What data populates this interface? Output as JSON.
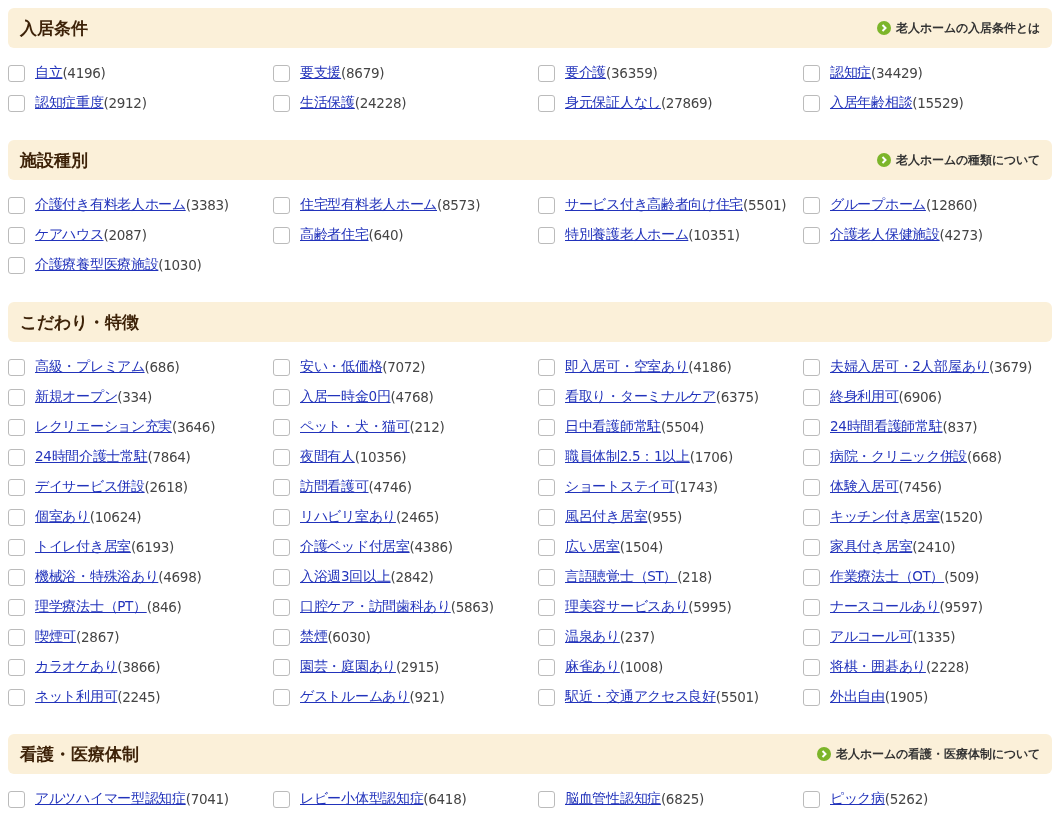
{
  "sections": [
    {
      "title": "入居条件",
      "link": "老人ホームの入居条件とは",
      "items": [
        {
          "label": "自立",
          "count": "(4196)",
          "checked": false
        },
        {
          "label": "要支援",
          "count": "(8679)",
          "checked": false
        },
        {
          "label": "要介護",
          "count": "(36359)",
          "checked": false
        },
        {
          "label": "認知症",
          "count": "(34429)",
          "checked": false
        },
        {
          "label": "認知症重度",
          "count": "(2912)",
          "checked": false
        },
        {
          "label": "生活保護",
          "count": "(24228)",
          "checked": false
        },
        {
          "label": "身元保証人なし",
          "count": "(27869)",
          "checked": false
        },
        {
          "label": "入居年齢相談",
          "count": "(15529)",
          "checked": false
        }
      ]
    },
    {
      "title": "施設種別",
      "link": "老人ホームの種類について",
      "items": [
        {
          "label": "介護付き有料老人ホーム",
          "count": "(3383)",
          "checked": false
        },
        {
          "label": "住宅型有料老人ホーム",
          "count": "(8573)",
          "checked": false
        },
        {
          "label": "サービス付き高齢者向け住宅",
          "count": "(5501)",
          "checked": false
        },
        {
          "label": "グループホーム",
          "count": "(12860)",
          "checked": false
        },
        {
          "label": "ケアハウス",
          "count": "(2087)",
          "checked": false
        },
        {
          "label": "高齢者住宅",
          "count": "(640)",
          "checked": false
        },
        {
          "label": "特別養護老人ホーム",
          "count": "(10351)",
          "checked": false
        },
        {
          "label": "介護老人保健施設",
          "count": "(4273)",
          "checked": false
        },
        {
          "label": "介護療養型医療施設",
          "count": "(1030)",
          "checked": false
        }
      ]
    },
    {
      "title": "こだわり・特徴",
      "items": [
        {
          "label": "高級・プレミアム",
          "count": "(686)",
          "checked": false
        },
        {
          "label": "安い・低価格",
          "count": "(7072)",
          "checked": false
        },
        {
          "label": "即入居可・空室あり",
          "count": "(4186)",
          "checked": false
        },
        {
          "label": "夫婦入居可・2人部屋あり",
          "count": "(3679)",
          "checked": false
        },
        {
          "label": "新規オープン",
          "count": "(334)",
          "checked": false
        },
        {
          "label": "入居一時金0円",
          "count": "(4768)",
          "checked": false
        },
        {
          "label": "看取り・ターミナルケア",
          "count": "(6375)",
          "checked": false
        },
        {
          "label": "終身利用可",
          "count": "(6906)",
          "checked": false
        },
        {
          "label": "レクリエーション充実",
          "count": "(3646)",
          "checked": false
        },
        {
          "label": "ペット・犬・猫可",
          "count": "(212)",
          "checked": false
        },
        {
          "label": "日中看護師常駐",
          "count": "(5504)",
          "checked": false
        },
        {
          "label": "24時間看護師常駐",
          "count": "(837)",
          "checked": false
        },
        {
          "label": "24時間介護士常駐",
          "count": "(7864)",
          "checked": false
        },
        {
          "label": "夜間有人",
          "count": "(10356)",
          "checked": false
        },
        {
          "label": "職員体制2.5：1以上",
          "count": "(1706)",
          "checked": false
        },
        {
          "label": "病院・クリニック併設",
          "count": "(668)",
          "checked": false
        },
        {
          "label": "デイサービス併設",
          "count": "(2618)",
          "checked": false
        },
        {
          "label": "訪問看護可",
          "count": "(4746)",
          "checked": false
        },
        {
          "label": "ショートステイ可",
          "count": "(1743)",
          "checked": false
        },
        {
          "label": "体験入居可",
          "count": "(7456)",
          "checked": false
        },
        {
          "label": "個室あり",
          "count": "(10624)",
          "checked": false
        },
        {
          "label": "リハビリ室あり",
          "count": "(2465)",
          "checked": false
        },
        {
          "label": "風呂付き居室",
          "count": "(955)",
          "checked": false
        },
        {
          "label": "キッチン付き居室",
          "count": "(1520)",
          "checked": false
        },
        {
          "label": "トイレ付き居室",
          "count": "(6193)",
          "checked": false
        },
        {
          "label": "介護ベッド付居室",
          "count": "(4386)",
          "checked": false
        },
        {
          "label": "広い居室",
          "count": "(1504)",
          "checked": false
        },
        {
          "label": "家具付き居室",
          "count": "(2410)",
          "checked": false
        },
        {
          "label": "機械浴・特殊浴あり",
          "count": "(4698)",
          "checked": false
        },
        {
          "label": "入浴週3回以上",
          "count": "(2842)",
          "checked": false
        },
        {
          "label": "言語聴覚士（ST）",
          "count": "(218)",
          "checked": false
        },
        {
          "label": "作業療法士（OT）",
          "count": "(509)",
          "checked": false
        },
        {
          "label": "理学療法士（PT）",
          "count": "(846)",
          "checked": false
        },
        {
          "label": "口腔ケア・訪問歯科あり",
          "count": "(5863)",
          "checked": false
        },
        {
          "label": "理美容サービスあり",
          "count": "(5995)",
          "checked": false
        },
        {
          "label": "ナースコールあり",
          "count": "(9597)",
          "checked": false
        },
        {
          "label": "喫煙可",
          "count": "(2867)",
          "checked": false
        },
        {
          "label": "禁煙",
          "count": "(6030)",
          "checked": false
        },
        {
          "label": "温泉あり",
          "count": "(237)",
          "checked": false
        },
        {
          "label": "アルコール可",
          "count": "(1335)",
          "checked": false
        },
        {
          "label": "カラオケあり",
          "count": "(3866)",
          "checked": false
        },
        {
          "label": "園芸・庭園あり",
          "count": "(2915)",
          "checked": false
        },
        {
          "label": "麻雀あり",
          "count": "(1008)",
          "checked": false
        },
        {
          "label": "将棋・囲碁あり",
          "count": "(2228)",
          "checked": false
        },
        {
          "label": "ネット利用可",
          "count": "(2245)",
          "checked": false
        },
        {
          "label": "ゲストルームあり",
          "count": "(921)",
          "checked": false
        },
        {
          "label": "駅近・交通アクセス良好",
          "count": "(5501)",
          "checked": false
        },
        {
          "label": "外出自由",
          "count": "(1905)",
          "checked": false
        }
      ]
    },
    {
      "title": "看護・医療体制",
      "link": "老人ホームの看護・医療体制について",
      "items": [
        {
          "label": "アルツハイマー型認知症",
          "count": "(7041)",
          "checked": false
        },
        {
          "label": "レビー小体型認知症",
          "count": "(6418)",
          "checked": false
        },
        {
          "label": "脳血管性認知症",
          "count": "(6825)",
          "checked": false
        },
        {
          "label": "ピック病",
          "count": "(5262)",
          "checked": false
        }
      ]
    }
  ]
}
